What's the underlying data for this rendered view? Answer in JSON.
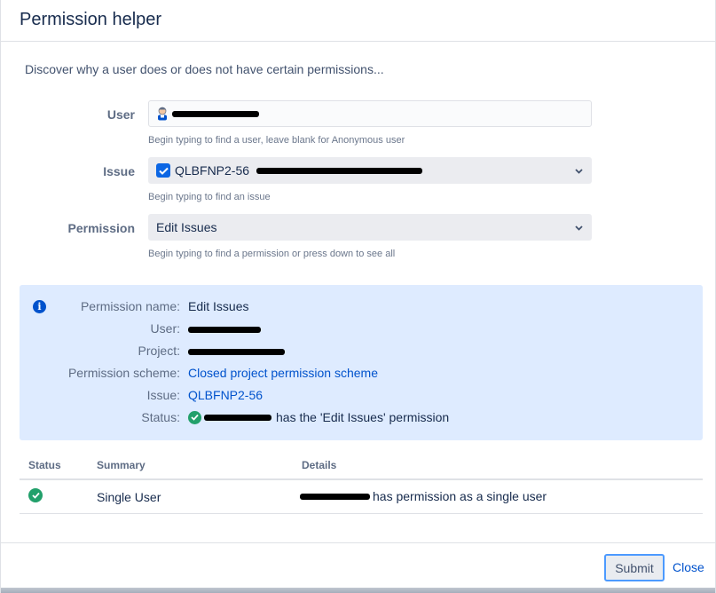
{
  "dialog": {
    "title": "Permission helper"
  },
  "intro": "Discover why a user does or does not have certain permissions...",
  "form": {
    "user": {
      "label": "User",
      "value": "",
      "hint": "Begin typing to find a user, leave blank for Anonymous user",
      "avatar_icon": "user-avatar-icon"
    },
    "issue": {
      "label": "Issue",
      "value": "QLBFNP2-56",
      "hint": "Begin typing to find an issue",
      "icon": "checkbox-issue-type-icon"
    },
    "permission": {
      "label": "Permission",
      "value": "Edit Issues",
      "hint": "Begin typing to find a permission or press down to see all"
    }
  },
  "info": {
    "icon": "info-icon",
    "permission_name": {
      "label": "Permission name:",
      "value": "Edit Issues"
    },
    "user": {
      "label": "User:"
    },
    "project": {
      "label": "Project:"
    },
    "permission_scheme": {
      "label": "Permission scheme:",
      "value": "Closed project permission scheme"
    },
    "issue": {
      "label": "Issue:",
      "value": "QLBFNP2-56"
    },
    "status": {
      "label": "Status:",
      "suffix": "has the 'Edit Issues' permission"
    }
  },
  "results": {
    "headers": {
      "status": "Status",
      "summary": "Summary",
      "details": "Details"
    },
    "rows": [
      {
        "summary": "Single User",
        "details_suffix": "has permission as a single user"
      }
    ]
  },
  "footer": {
    "submit_label": "Submit",
    "close_label": "Close"
  },
  "colors": {
    "accent": "#0052cc",
    "success": "#22a06b",
    "info_bg": "#deebff",
    "focus": "#4c9aff"
  }
}
